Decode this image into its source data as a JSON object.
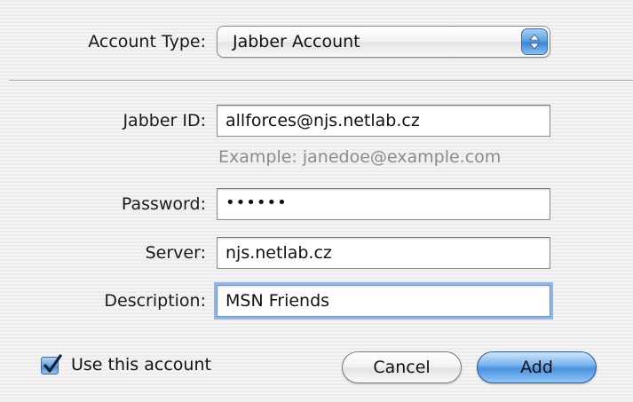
{
  "account_type": {
    "label": "Account Type:",
    "selected": "Jabber Account"
  },
  "form": {
    "jabber_id": {
      "label": "Jabber ID:",
      "value": "allforces@njs.netlab.cz",
      "hint": "Example: janedoe@example.com"
    },
    "password": {
      "label": "Password:",
      "value": "••••••"
    },
    "server": {
      "label": "Server:",
      "value": "njs.netlab.cz"
    },
    "description": {
      "label": "Description:",
      "value": "MSN Friends"
    }
  },
  "use_account": {
    "label": "Use this account",
    "checked": true
  },
  "buttons": {
    "cancel": "Cancel",
    "add": "Add"
  },
  "colors": {
    "accent": "#4d92df",
    "hint_text": "#8c8c8c"
  },
  "icons": {
    "popup_stepper": "up-down-arrows-icon",
    "checkbox": "checkmark-icon"
  }
}
